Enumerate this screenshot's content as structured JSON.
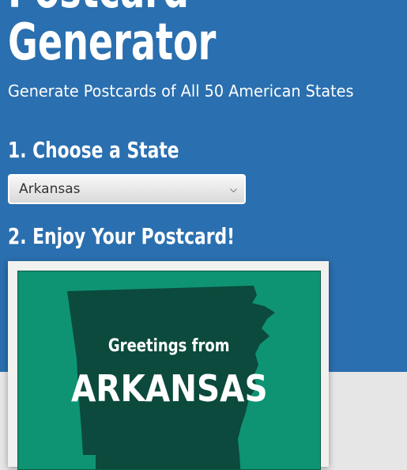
{
  "header": {
    "title_line_1": "Postcard",
    "title_line_2": "Generator",
    "subtitle": "Generate Postcards of All 50 American States"
  },
  "steps": {
    "choose_label": "1. Choose a State",
    "enjoy_label": "2. Enjoy Your Postcard!"
  },
  "state_select": {
    "selected": "Arkansas",
    "icon": "chevron-down-icon"
  },
  "postcard": {
    "greeting": "Greetings from",
    "state_name": "ARKANSAS",
    "colors": {
      "background": "#0e9473",
      "state_fill": "#0b4a3c",
      "text": "#ffffff"
    }
  },
  "colors": {
    "hero_background": "#2a6faf",
    "page_background": "#e6e6e6"
  }
}
